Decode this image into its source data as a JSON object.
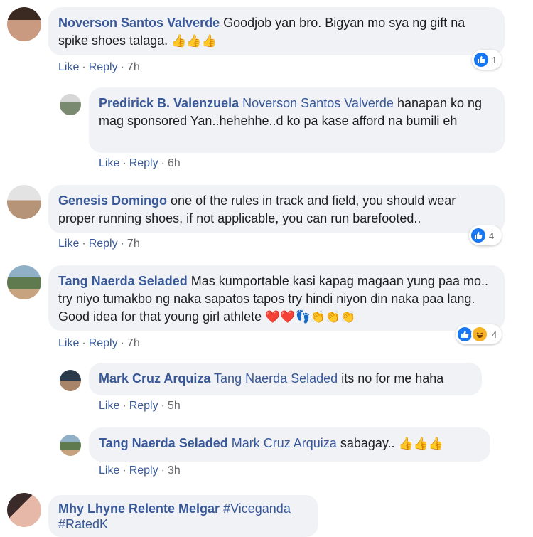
{
  "comments": [
    {
      "author": "Noverson Santos Valverde",
      "text": "Goodjob yan bro. Bigyan mo sya ng gift na spike shoes talaga.",
      "emoji": "👍👍👍",
      "actions": {
        "like": "Like",
        "reply": "Reply",
        "time": "7h"
      },
      "reaction_count": "1"
    },
    {
      "author": "Predirick B. Valenzuela",
      "mention": "Noverson Santos Valverde",
      "text": "hanapan ko ng mag sponsored Yan..hehehhe..d ko pa kase afford na bumili eh",
      "actions": {
        "like": "Like",
        "reply": "Reply",
        "time": "6h"
      }
    },
    {
      "author": "Genesis Domingo",
      "text": "one of the rules in track and field, you should wear proper running shoes, if not applicable, you can run barefooted..",
      "actions": {
        "like": "Like",
        "reply": "Reply",
        "time": "7h"
      },
      "reaction_count": "4"
    },
    {
      "author": "Tang Naerda Seladed",
      "text": "Mas kumportable kasi kapag magaan yung paa mo.. try niyo tumakbo ng naka sapatos tapos try hindi niyon din naka paa lang. Good idea for that young girl athlete",
      "emoji": "❤️❤️👣👏👏👏",
      "actions": {
        "like": "Like",
        "reply": "Reply",
        "time": "7h"
      },
      "reaction_count": "4"
    },
    {
      "author": "Mark Cruz Arquiza",
      "mention": "Tang Naerda Seladed",
      "text": "its no for me haha",
      "actions": {
        "like": "Like",
        "reply": "Reply",
        "time": "5h"
      }
    },
    {
      "author": "Tang Naerda Seladed",
      "mention": "Mark Cruz Arquiza",
      "text": "sabagay..",
      "emoji": "👍👍👍",
      "actions": {
        "like": "Like",
        "reply": "Reply",
        "time": "3h"
      }
    },
    {
      "author": "Mhy Lhyne Relente Melgar",
      "text": "#Viceganda #RatedK"
    }
  ],
  "colors": {
    "author": "#385898",
    "bubble": "#f0f2f5",
    "like": "#1877f2",
    "meta": "#65676b"
  },
  "icons": {
    "like": "thumbs-up-icon",
    "haha": "laughing-face-icon"
  }
}
